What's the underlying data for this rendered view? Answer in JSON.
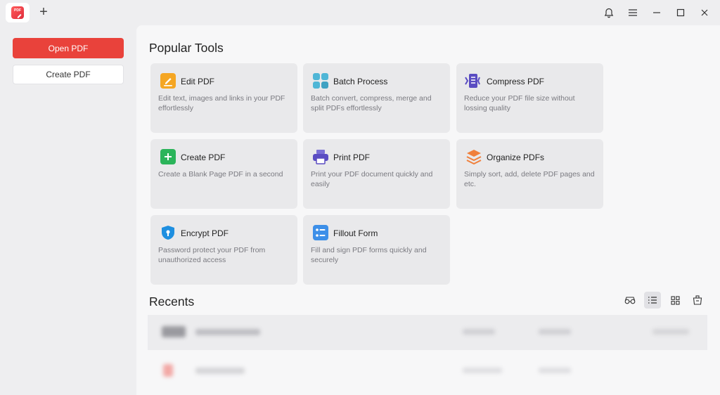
{
  "app": {
    "logo_text": "PDF"
  },
  "titlebar": {
    "new_tab_symbol": "+",
    "icons": [
      "bell-icon",
      "menu-icon",
      "minimize-icon",
      "maximize-icon",
      "close-icon"
    ]
  },
  "sidebar": {
    "open_pdf_label": "Open PDF",
    "create_pdf_label": "Create PDF"
  },
  "popular_tools": {
    "title": "Popular Tools",
    "tools": [
      {
        "name": "Edit PDF",
        "desc": "Edit text, images and links in your PDF effortlessly",
        "icon": "edit-icon"
      },
      {
        "name": "Batch Process",
        "desc": "Batch convert, compress, merge and split PDFs effortlessly",
        "icon": "batch-icon"
      },
      {
        "name": "Compress PDF",
        "desc": "Reduce your PDF file size without lossing quality",
        "icon": "compress-icon"
      },
      {
        "name": "Create PDF",
        "desc": "Create a Blank Page PDF in a second",
        "icon": "create-icon"
      },
      {
        "name": "Print PDF",
        "desc": "Print your PDF document quickly and easily",
        "icon": "print-icon"
      },
      {
        "name": "Organize PDFs",
        "desc": "Simply sort, add, delete PDF pages and etc.",
        "icon": "organize-icon"
      },
      {
        "name": "Encrypt PDF",
        "desc": "Password protect your PDF from unauthorized access",
        "icon": "shield-icon"
      },
      {
        "name": "Fillout Form",
        "desc": "Fill and sign PDF forms quickly and securely",
        "icon": "form-icon"
      }
    ]
  },
  "recents": {
    "title": "Recents",
    "view_modes": [
      "glasses-icon",
      "list-view-icon",
      "grid-view-icon",
      "cleanup-icon"
    ],
    "active_view": "list-view-icon"
  },
  "colors": {
    "accent": "#e9423b",
    "card_bg": "#e9e9eb",
    "panel_bg": "#f7f7f8",
    "chrome_bg": "#eeeef0"
  }
}
